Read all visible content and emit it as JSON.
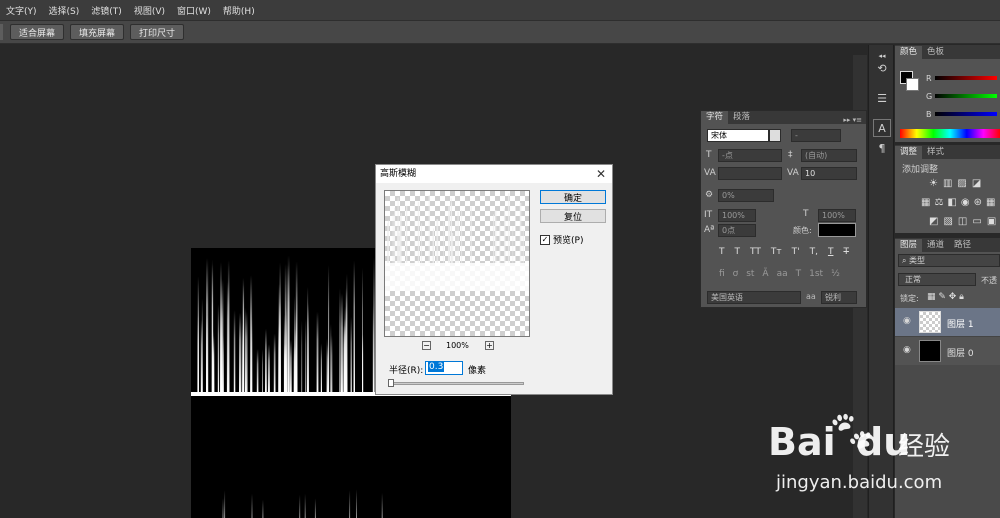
{
  "menu": [
    "文字(Y)",
    "选择(S)",
    "滤镜(T)",
    "视图(V)",
    "窗口(W)",
    "帮助(H)"
  ],
  "options_bar": {
    "fit_screen": "适合屏幕",
    "fill_screen": "填充屏幕",
    "print_size": "打印尺寸"
  },
  "color_panel": {
    "tabs": [
      "颜色",
      "色板"
    ],
    "channels": [
      "R",
      "G",
      "B"
    ]
  },
  "adjustments_panel": {
    "tabs": [
      "调整",
      "样式"
    ],
    "add_label": "添加调整"
  },
  "layers_panel": {
    "tabs": [
      "图层",
      "通道",
      "路径"
    ],
    "filter_label": "类型",
    "blend_mode": "正常",
    "opacity_label": "不透",
    "lock_label": "锁定:",
    "layers": [
      {
        "name": "图层 1",
        "selected": true
      },
      {
        "name": "图层 0",
        "selected": false
      }
    ]
  },
  "character_panel": {
    "tabs": [
      "字符",
      "段落"
    ],
    "font_family": "宋体",
    "font_style": "-",
    "font_size": "-点",
    "leading": "(自动)",
    "tracking": "10",
    "scale_pct": "0%",
    "vertical_scale": "100%",
    "horizontal_scale": "100%",
    "baseline": "0点",
    "color_label": "颜色:",
    "style_buttons": [
      "T",
      "T",
      "TT",
      "Tт",
      "T'",
      "T,",
      "T",
      "T"
    ],
    "language": "美国英语",
    "antialias_icon": "aa",
    "antialias": "锐利"
  },
  "dialog": {
    "title": "高斯模糊",
    "ok": "确定",
    "reset": "复位",
    "preview_label": "预览(P)",
    "preview_checked": true,
    "zoom": "100%",
    "radius_label": "半径(R):",
    "radius_value": "0.3",
    "radius_unit": "像素",
    "radius_slider": 0.0
  },
  "watermark": {
    "brand": "Bai",
    "brand2": "du",
    "cn": "经验",
    "url": "jingyan.baidu.com"
  },
  "colors": {
    "accent": "#0078d7",
    "panel": "#535353",
    "canvas": "#282828"
  }
}
